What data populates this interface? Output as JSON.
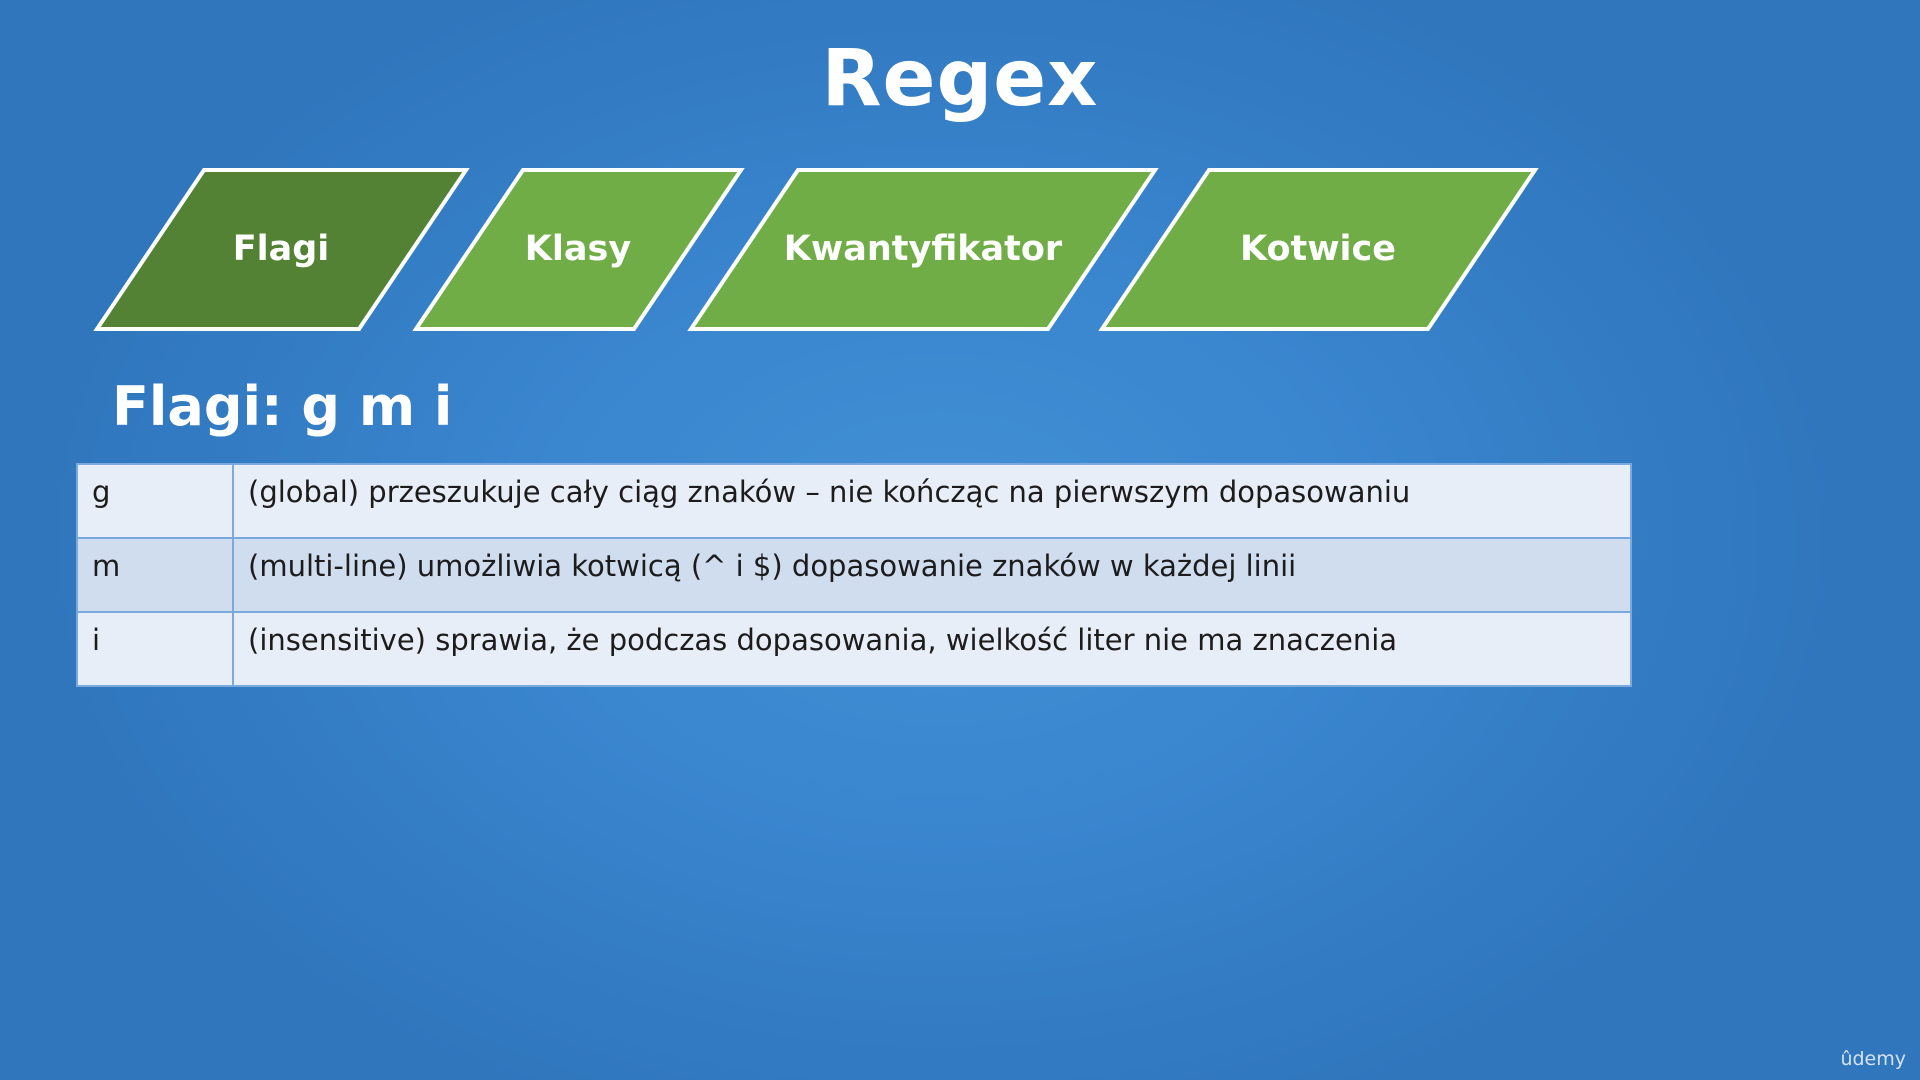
{
  "title": "Regex",
  "nav": {
    "tabs": [
      {
        "label": "Flagi",
        "active": true
      },
      {
        "label": "Klasy",
        "active": false
      },
      {
        "label": "Kwantyfikator",
        "active": false
      },
      {
        "label": "Kotwice",
        "active": false
      }
    ]
  },
  "section_heading": "Flagi: g m i",
  "flags_table": [
    {
      "flag": "g",
      "description": "(global) przeszukuje cały ciąg znaków – nie kończąc na pierwszym dopasowaniu"
    },
    {
      "flag": "m",
      "description": "(multi-line) umożliwia kotwicą (^ i $) dopasowanie znaków w każdej linii"
    },
    {
      "flag": "i",
      "description": "(insensitive) sprawia, że podczas dopasowania, wielkość liter nie ma znaczenia"
    }
  ],
  "watermark": "ûdemy",
  "colors": {
    "background": "#3a86cf",
    "tab_active": "#548235",
    "tab_inactive": "#70ad47",
    "table_row_light": "#e8eef8",
    "table_row_dark": "#d0ddef",
    "table_border": "#7aa9dd"
  }
}
